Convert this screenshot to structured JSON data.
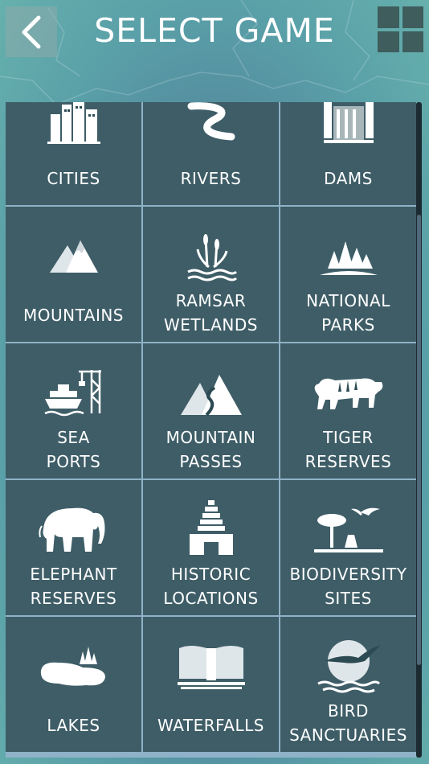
{
  "header": {
    "title": "SELECT GAME",
    "back_icon": "chevron-left-icon",
    "grid_icon": "grid-view-icon"
  },
  "tiles": [
    {
      "label": "CITIES",
      "icon": "cities-icon"
    },
    {
      "label": "RIVERS",
      "icon": "rivers-icon"
    },
    {
      "label": "DAMS",
      "icon": "dams-icon"
    },
    {
      "label": "MOUNTAINS",
      "icon": "mountains-icon"
    },
    {
      "label": "RAMSAR WETLANDS",
      "icon": "wetlands-icon"
    },
    {
      "label": "NATIONAL PARKS",
      "icon": "national-parks-icon"
    },
    {
      "label": "SEA PORTS",
      "icon": "sea-port-icon"
    },
    {
      "label": "MOUNTAIN PASSES",
      "icon": "mountain-pass-icon"
    },
    {
      "label": "TIGER RESERVES",
      "icon": "tiger-icon"
    },
    {
      "label": "ELEPHANT RESERVES",
      "icon": "elephant-icon"
    },
    {
      "label": "HISTORIC LOCATIONS",
      "icon": "historic-temple-icon"
    },
    {
      "label": "BIODIVERSITY SITES",
      "icon": "biodiversity-icon"
    },
    {
      "label": "LAKES",
      "icon": "lakes-icon"
    },
    {
      "label": "WATERFALLS",
      "icon": "waterfall-icon"
    },
    {
      "label": "BIRD SANCTUARIES",
      "icon": "bird-icon"
    }
  ],
  "colors": {
    "tile_background": "#2c4a52",
    "grid_border": "#8fb2c8",
    "text": "#ffffff"
  }
}
